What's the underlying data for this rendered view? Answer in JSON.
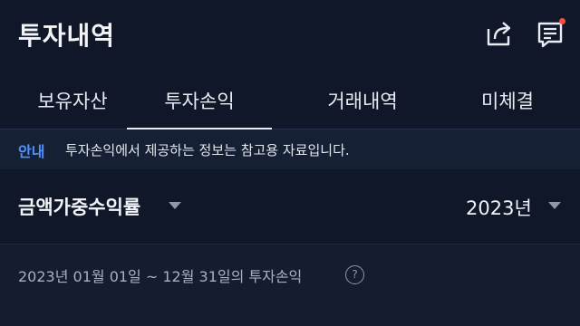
{
  "header": {
    "title": "투자내역",
    "icons": [
      "share-icon",
      "notes-icon"
    ],
    "notification_dot_color": "#ff4c3b"
  },
  "tabs": [
    {
      "label": "보유자산",
      "active": false
    },
    {
      "label": "투자손익",
      "active": true
    },
    {
      "label": "거래내역",
      "active": false
    },
    {
      "label": "미체결",
      "active": false
    }
  ],
  "notice": {
    "tag": "안내",
    "text": "투자손익에서 제공하는 정보는 참고용 자료입니다."
  },
  "filter": {
    "metric_label": "금액가중수익률",
    "year_label": "2023년"
  },
  "summary": {
    "period_text": "2023년 01월 01일 ~ 12월 31일의 투자손익",
    "help_glyph": "?"
  },
  "colors": {
    "background": "#0f1729",
    "accent_blue": "#4f92ff",
    "notice_bg": "#162035"
  }
}
